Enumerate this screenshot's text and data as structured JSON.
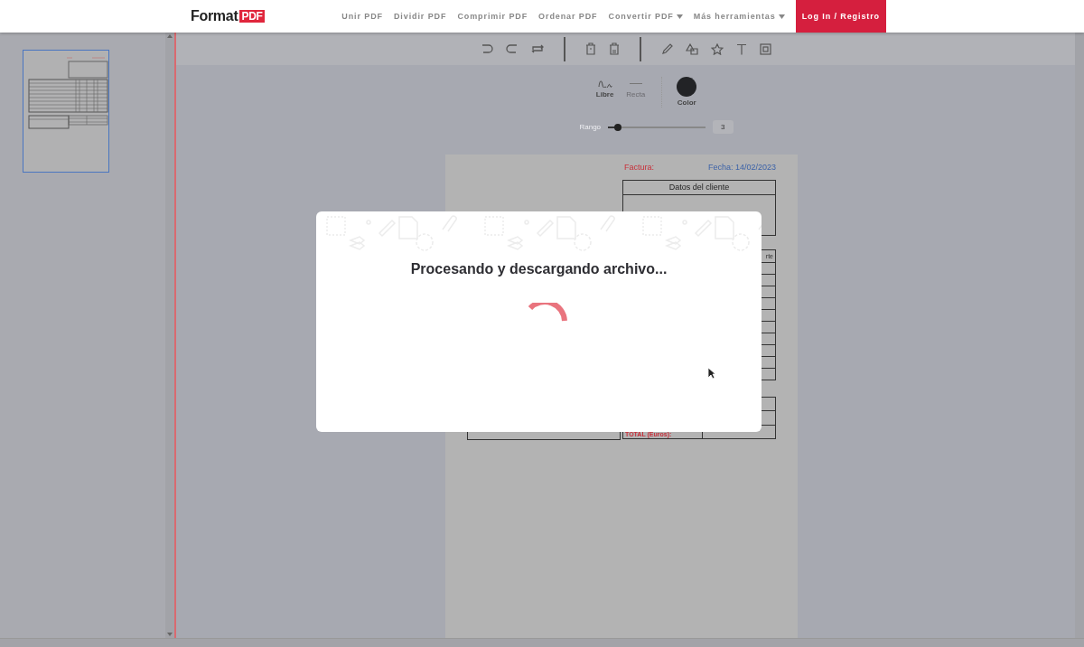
{
  "header": {
    "logo": {
      "text": "Format",
      "badge": "PDF"
    },
    "nav": [
      {
        "label": "Unir PDF",
        "dropdown": false
      },
      {
        "label": "Dividir PDF",
        "dropdown": false
      },
      {
        "label": "Comprimir PDF",
        "dropdown": false
      },
      {
        "label": "Ordenar PDF",
        "dropdown": false
      },
      {
        "label": "Convertir PDF",
        "dropdown": true
      },
      {
        "label": "Más herramientas",
        "dropdown": true
      }
    ],
    "login": "Log In / Registro"
  },
  "sidebar": {
    "pages": [
      {
        "selected": true
      }
    ]
  },
  "draw_options": {
    "modes": [
      {
        "label": "Libre",
        "kind": "free",
        "selected": true
      },
      {
        "label": "Recta",
        "kind": "line",
        "selected": false
      }
    ],
    "color_label": "Color",
    "slider": {
      "label": "Rango",
      "level": 0.1,
      "value": "3"
    }
  },
  "document": {
    "invoice_label": "Factura:",
    "date": "Fecha: 14/02/2023",
    "client_header": "Datos del cliente",
    "column_fragment": "rte",
    "total_label": "TOTAL (Euros):"
  },
  "modal": {
    "title": "Procesando y descargando archivo..."
  }
}
